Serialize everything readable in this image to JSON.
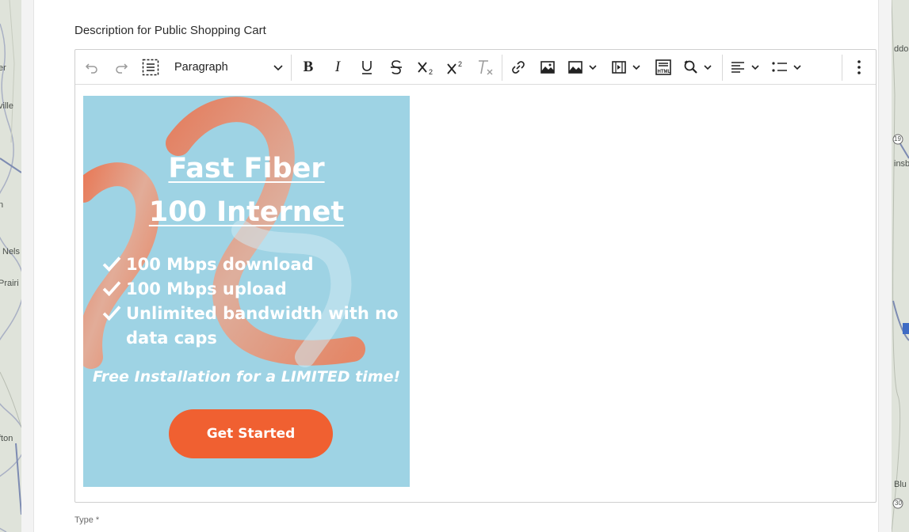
{
  "map": {
    "left_labels": [
      "er",
      "ville",
      "n",
      "Nels",
      "Prairi",
      "fton"
    ],
    "right_labels": [
      "ddor",
      "19",
      "insb",
      "Blu",
      "30"
    ]
  },
  "form": {
    "description_label": "Description for Public Shopping Cart",
    "type_label": "Type *"
  },
  "toolbar": {
    "items": [
      {
        "name": "undo-button",
        "icon": "undo-icon"
      },
      {
        "name": "redo-button",
        "icon": "redo-icon"
      },
      {
        "name": "select-all-button",
        "icon": "select-all-icon"
      },
      {
        "name": "bold-button",
        "icon": "bold-icon"
      },
      {
        "name": "italic-button",
        "icon": "italic-icon"
      },
      {
        "name": "underline-button",
        "icon": "underline-icon"
      },
      {
        "name": "strikethrough-button",
        "icon": "strikethrough-icon"
      },
      {
        "name": "subscript-button",
        "icon": "subscript-icon"
      },
      {
        "name": "superscript-button",
        "icon": "superscript-icon"
      },
      {
        "name": "clear-formatting-button",
        "icon": "clear-formatting-icon"
      },
      {
        "name": "link-button",
        "icon": "link-icon"
      },
      {
        "name": "image-button",
        "icon": "image-icon"
      },
      {
        "name": "insert-image-dropdown",
        "icon": "image-icon"
      },
      {
        "name": "media-dropdown",
        "icon": "media-icon"
      },
      {
        "name": "html-embed-button",
        "icon": "html-icon"
      },
      {
        "name": "find-replace-dropdown",
        "icon": "find-replace-icon"
      },
      {
        "name": "alignment-dropdown",
        "icon": "align-left-icon"
      },
      {
        "name": "list-dropdown",
        "icon": "bulleted-list-icon"
      },
      {
        "name": "more-options-button",
        "icon": "vertical-dots-icon"
      }
    ],
    "heading_select": {
      "value": "Paragraph"
    }
  },
  "ad": {
    "title_line1": "Fast Fiber ",
    "title_line2": "100 Internet",
    "features": [
      "100 Mbps download",
      "100 Mbps upload",
      "Unlimited bandwidth with no data caps"
    ],
    "promo": "Free Installation for a LIMITED time!",
    "cta": "Get Started",
    "colors": {
      "background": "#9ed3e4",
      "accent": "#f06031",
      "text": "#ffffff"
    }
  }
}
